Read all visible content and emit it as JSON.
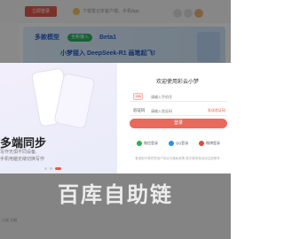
{
  "topbar": {
    "button_label": "立即登录",
    "center_text": "下载笔记本客户端、手机App"
  },
  "banner": {
    "tag1": "多款模型",
    "tag2": "全新接入",
    "tag3": "Beta1",
    "headline": "小梦接入 DeepSeek-R1 画笔起飞!"
  },
  "modal": {
    "left_title": "多端同步",
    "left_sub1": "写作无惧不同设备,",
    "left_sub2": "手机电脑无缝切换写作",
    "right_title": "欢迎使用彩云小梦",
    "phone": {
      "prefix": "+86",
      "placeholder": "请输入手机号"
    },
    "code": {
      "label": "验证码",
      "placeholder": "请输入验证码",
      "send_label": "发送验证码"
    },
    "login_label": "登录",
    "oauth": [
      {
        "label": "微信登录",
        "icon": "wechat-icon"
      },
      {
        "label": "QQ登录",
        "icon": "qq-icon"
      },
      {
        "label": "微博登录",
        "icon": "weibo-icon"
      }
    ],
    "agreement": "登录即代表同意用户协议与隐私政策,首次登录将自动注册账号"
  },
  "watermark": "百库自助链",
  "footnote": "小说 大纲"
}
